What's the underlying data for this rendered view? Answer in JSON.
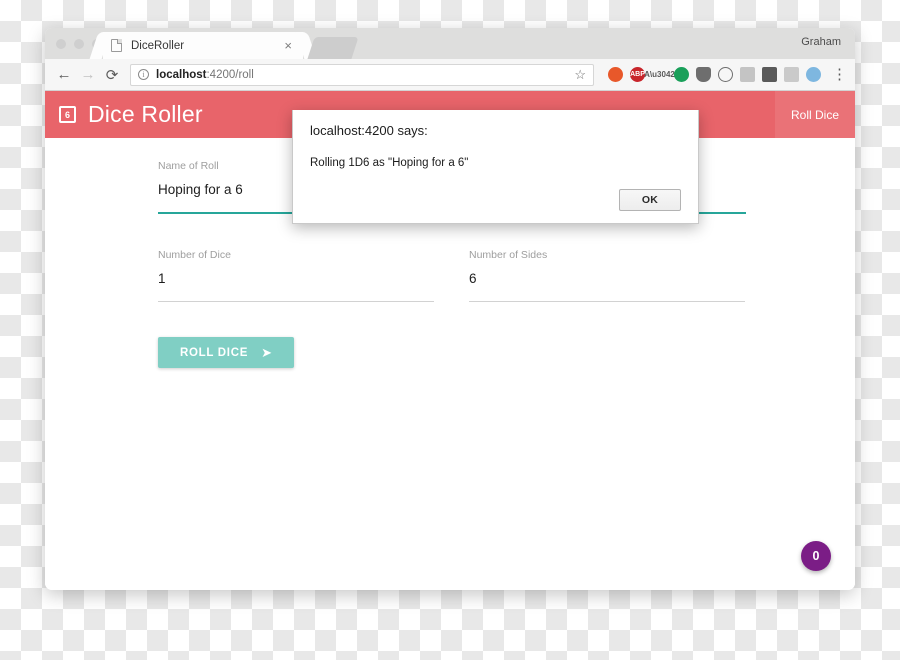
{
  "browser": {
    "profile_name": "Graham",
    "tab": {
      "title": "DiceRoller",
      "close_label": "×",
      "favicon": "page-icon"
    },
    "nav": {
      "back": "←",
      "forward": "→",
      "reload": "⟳"
    },
    "omnibox": {
      "info_icon": "ⓘ",
      "host": "localhost",
      "path": ":4200/roll",
      "star_icon": "☆"
    },
    "extensions": [
      {
        "name": "color-wheel-extension",
        "label": "",
        "color": "#e8582a",
        "shape": "circle"
      },
      {
        "name": "adblock-plus-extension",
        "label": "ABP",
        "color": "#c8252b",
        "shape": "circle"
      },
      {
        "name": "translate-extension",
        "label": "Aあ",
        "color": "#6e6e6e",
        "shape": "square"
      },
      {
        "name": "pocket-extension",
        "label": "",
        "color": "#1aa05a",
        "shape": "circle"
      },
      {
        "name": "shield-extension",
        "label": "",
        "color": "#6e6e6e",
        "shape": "circle"
      },
      {
        "name": "history-extension",
        "label": "",
        "color": "#6e6e6e",
        "shape": "circle"
      },
      {
        "name": "notes-extension",
        "label": "",
        "color": "#c4c4c4",
        "shape": "square"
      },
      {
        "name": "incognito-extension",
        "label": "",
        "color": "#5a5a5a",
        "shape": "square"
      },
      {
        "name": "grammar-extension",
        "label": "",
        "color": "#cacaca",
        "shape": "square"
      },
      {
        "name": "globe-extension",
        "label": "",
        "color": "#7eb7e0",
        "shape": "circle"
      }
    ],
    "menu_dots": "⋮"
  },
  "app": {
    "logo_label": "6",
    "title": "Dice Roller",
    "header_action": "Roll Dice",
    "accent_color": "#e8646a",
    "fab": {
      "count": "0",
      "color": "#7b1d86"
    },
    "form": {
      "fields": [
        {
          "label": "Name of Roll",
          "value": "Hoping for a 6",
          "focused": true
        },
        {
          "label": "Number of Dice",
          "value": "1",
          "focused": false
        },
        {
          "label": "Number of Sides",
          "value": "6",
          "focused": false
        }
      ],
      "submit_label": "ROLL DICE",
      "submit_icon": "➤"
    }
  },
  "dialog": {
    "origin": "localhost:4200 says:",
    "message": "Rolling 1D6 as \"Hoping for a 6\"",
    "ok_label": "OK"
  }
}
